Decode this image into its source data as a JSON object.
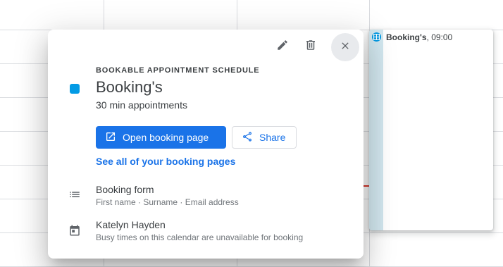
{
  "calendar_event": {
    "title": "Booking's",
    "time": ", 09:00",
    "icon": "booking-grid-icon",
    "colors": {
      "stripe": "#d2e7ef",
      "icon": "#039be5"
    }
  },
  "dialog": {
    "toolbar": {
      "edit_icon": "pencil-icon",
      "delete_icon": "trash-icon",
      "close_icon": "close-icon"
    },
    "eyebrow": "BOOKABLE APPOINTMENT SCHEDULE",
    "title": "Booking's",
    "subtitle": "30 min appointments",
    "accent_color": "#039be5",
    "open_booking_label": "Open booking page",
    "share_label": "Share",
    "see_all_link": "See all of your booking pages",
    "booking_form": {
      "icon": "list-icon",
      "title": "Booking form",
      "fields": "First name · Surname · Email address"
    },
    "calendar": {
      "icon": "calendar-icon",
      "owner": "Katelyn Hayden",
      "note": "Busy times on this calendar are unavailable for booking"
    }
  },
  "colors": {
    "primary": "#1a73e8",
    "grid_line": "#dadce0",
    "now_indicator": "#d93025"
  }
}
